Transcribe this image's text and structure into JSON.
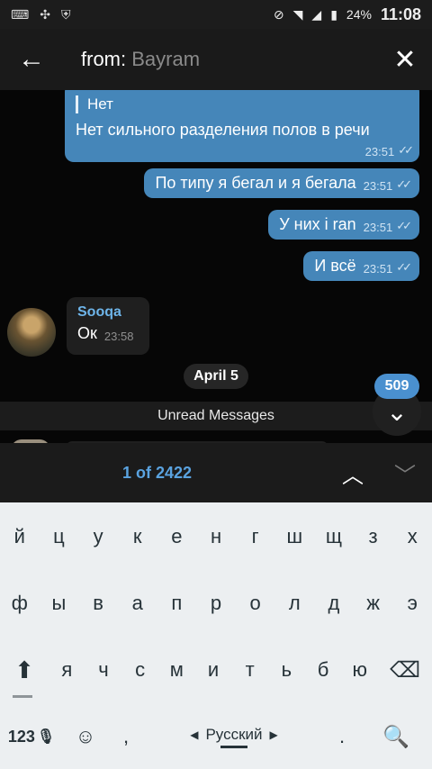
{
  "status": {
    "battery_pct": "24%",
    "time": "11:08"
  },
  "header": {
    "prefix": "from:",
    "user": "Bayram"
  },
  "messages": [
    {
      "reply_title": "Нет",
      "text": "Нет сильного разделения полов в речи",
      "time": "23:51"
    },
    {
      "text": "По типу я бегал и я бегала",
      "time": "23:51"
    },
    {
      "text": "У них  i ran",
      "time": "23:51"
    },
    {
      "text": "И всё",
      "time": "23:51"
    }
  ],
  "incoming": {
    "name": "Sooqa",
    "text": "Ок",
    "time": "23:58"
  },
  "date_pill": "April 5",
  "unread_label": "Unread Messages",
  "unread_count": "509",
  "search": {
    "counter": "1 of 2422"
  },
  "keyboard": {
    "row1": [
      "й",
      "ц",
      "у",
      "к",
      "е",
      "н",
      "г",
      "ш",
      "щ",
      "з",
      "х"
    ],
    "row2": [
      "ф",
      "ы",
      "в",
      "а",
      "п",
      "р",
      "о",
      "л",
      "д",
      "ж",
      "э"
    ],
    "row3": [
      "я",
      "ч",
      "с",
      "м",
      "и",
      "т",
      "ь",
      "б",
      "ю"
    ],
    "num_label": "123",
    "comma": ",",
    "space_label": "Русский",
    "dot": "."
  }
}
